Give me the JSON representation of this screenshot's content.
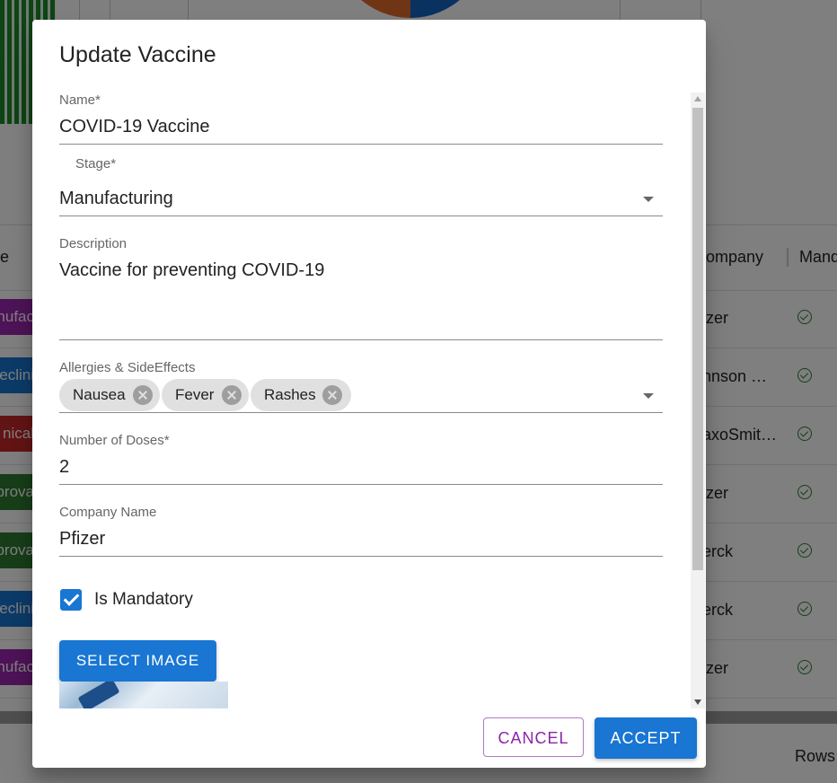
{
  "background": {
    "table_headers": [
      "e",
      "ompany",
      "Mand"
    ],
    "rows": [
      {
        "stage_fragment": "anufac",
        "stage_color": "#9c27b0",
        "company": "izer"
      },
      {
        "stage_fragment": "eclini",
        "stage_color": "#1976d2",
        "company": "nnson …"
      },
      {
        "stage_fragment": "nical",
        "stage_color": "#c62828",
        "company": "axoSmit…"
      },
      {
        "stage_fragment": "prova",
        "stage_color": "#2e7d32",
        "company": "izer"
      },
      {
        "stage_fragment": "prova",
        "stage_color": "#2e7d32",
        "company": "erck"
      },
      {
        "stage_fragment": "eclini",
        "stage_color": "#1976d2",
        "company": "erck"
      },
      {
        "stage_fragment": "anufac",
        "stage_color": "#9c27b0",
        "company": "izer"
      }
    ],
    "rows_label": "Rows"
  },
  "dialog": {
    "title": "Update Vaccine",
    "name": {
      "label": "Name*",
      "value": "COVID-19 Vaccine"
    },
    "stage": {
      "label": "Stage*",
      "value": "Manufacturing"
    },
    "description": {
      "label": "Description",
      "value": "Vaccine for preventing COVID-19"
    },
    "allergies": {
      "label": "Allergies & SideEffects",
      "chips": [
        "Nausea",
        "Fever",
        "Rashes"
      ]
    },
    "doses": {
      "label": "Number of Doses*",
      "value": "2"
    },
    "company": {
      "label": "Company Name",
      "value": "Pfizer"
    },
    "mandatory": {
      "label": "Is Mandatory",
      "checked": true
    },
    "select_image_label": "SELECT IMAGE",
    "cancel_label": "CANCEL",
    "accept_label": "ACCEPT"
  },
  "colors": {
    "primary": "#1976d2",
    "secondary": "#8e24aa",
    "success": "#2e7d32"
  }
}
